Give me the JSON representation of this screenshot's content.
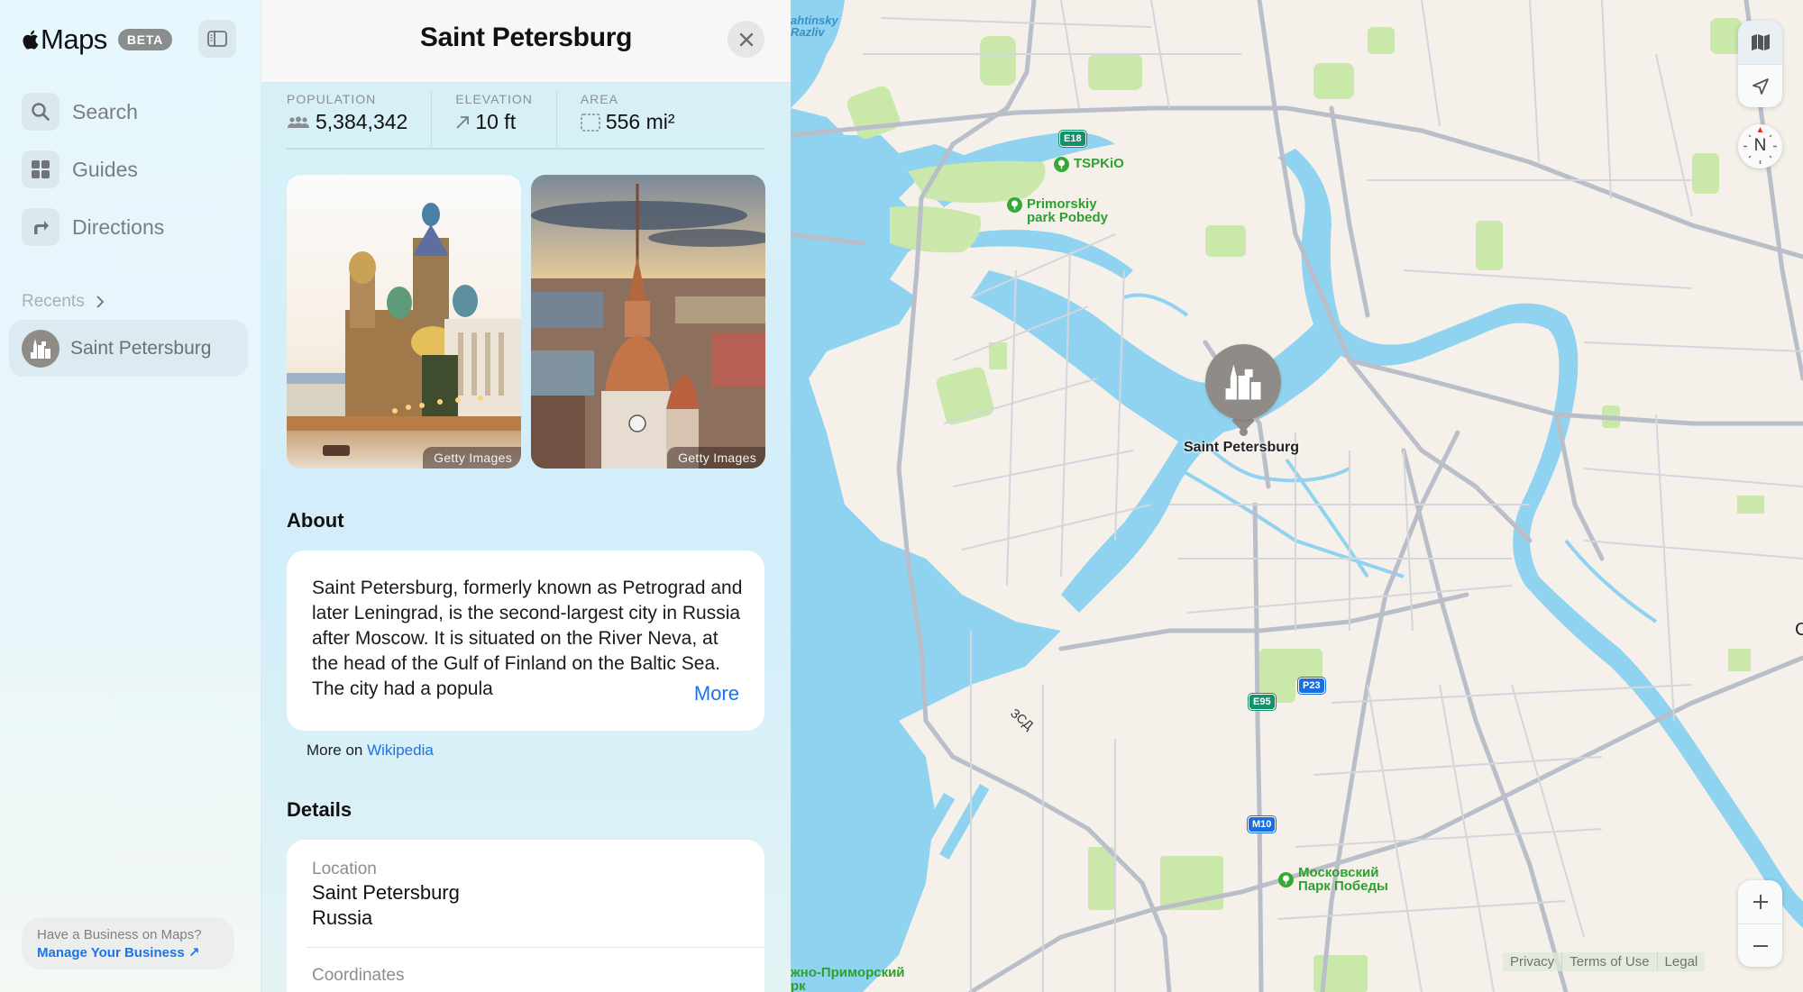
{
  "app": {
    "name": "Maps",
    "badge": "BETA"
  },
  "sidebar": {
    "toggle_icon": "sidebar-toggle-icon",
    "nav": [
      {
        "label": "Search",
        "icon": "search-icon"
      },
      {
        "label": "Guides",
        "icon": "grid-icon"
      },
      {
        "label": "Directions",
        "icon": "turn-right-arrow-icon"
      }
    ],
    "recents_label": "Recents",
    "recents": [
      {
        "label": "Saint Petersburg",
        "icon": "city-icon"
      }
    ],
    "business": {
      "question": "Have a Business on Maps?",
      "link": "Manage Your Business ↗"
    }
  },
  "panel": {
    "title": "Saint Petersburg",
    "stats": [
      {
        "label": "POPULATION",
        "value": "5,384,342",
        "icon": "people-icon"
      },
      {
        "label": "ELEVATION",
        "value": "10 ft",
        "icon": "elevation-arrow-icon"
      },
      {
        "label": "AREA",
        "value": "556 mi²",
        "icon": "area-dashed-square-icon"
      }
    ],
    "photos": [
      {
        "credit": "Getty Images",
        "subject": "Church of the Savior on Spilled Blood"
      },
      {
        "credit": "Getty Images",
        "subject": "City skyline with spire"
      }
    ],
    "about": {
      "heading": "About",
      "text": "Saint Petersburg, formerly known as Petrograd and later Leningrad, is the second-largest city in Russia after Moscow. It is situated on the River Neva, at the head of the Gulf of Finland on the Baltic Sea. The city had a popula",
      "more": "More",
      "source_prefix": "More on",
      "source_link": "Wikipedia"
    },
    "details": {
      "heading": "Details",
      "location_label": "Location",
      "location_line1": "Saint Petersburg",
      "location_line2": "Russia",
      "coordinates_label": "Coordinates"
    }
  },
  "map": {
    "labels": {
      "water": [
        "ahtinsky",
        "Razliv"
      ],
      "parks": [
        {
          "name": "TSPKiO"
        },
        {
          "name_line1": "Primorskiy",
          "name_line2": "park Pobedy"
        },
        {
          "name_line1": "Московский",
          "name_line2": "Парк Победы"
        },
        {
          "name_line1": "жно-Приморский",
          "name_line2": "рк"
        }
      ],
      "road": "ЗСД",
      "edge_partial": "C"
    },
    "shields": [
      "E18",
      "E95",
      "P23",
      "M10"
    ],
    "pin": {
      "label": "Saint Petersburg",
      "icon": "city-icon"
    },
    "controls": {
      "map_mode": "map-icon",
      "location": "location-arrow-icon",
      "compass": "N",
      "zoom_in": "+",
      "zoom_out": "−"
    },
    "footer": [
      "Privacy",
      "Terms of Use",
      "Legal"
    ]
  }
}
